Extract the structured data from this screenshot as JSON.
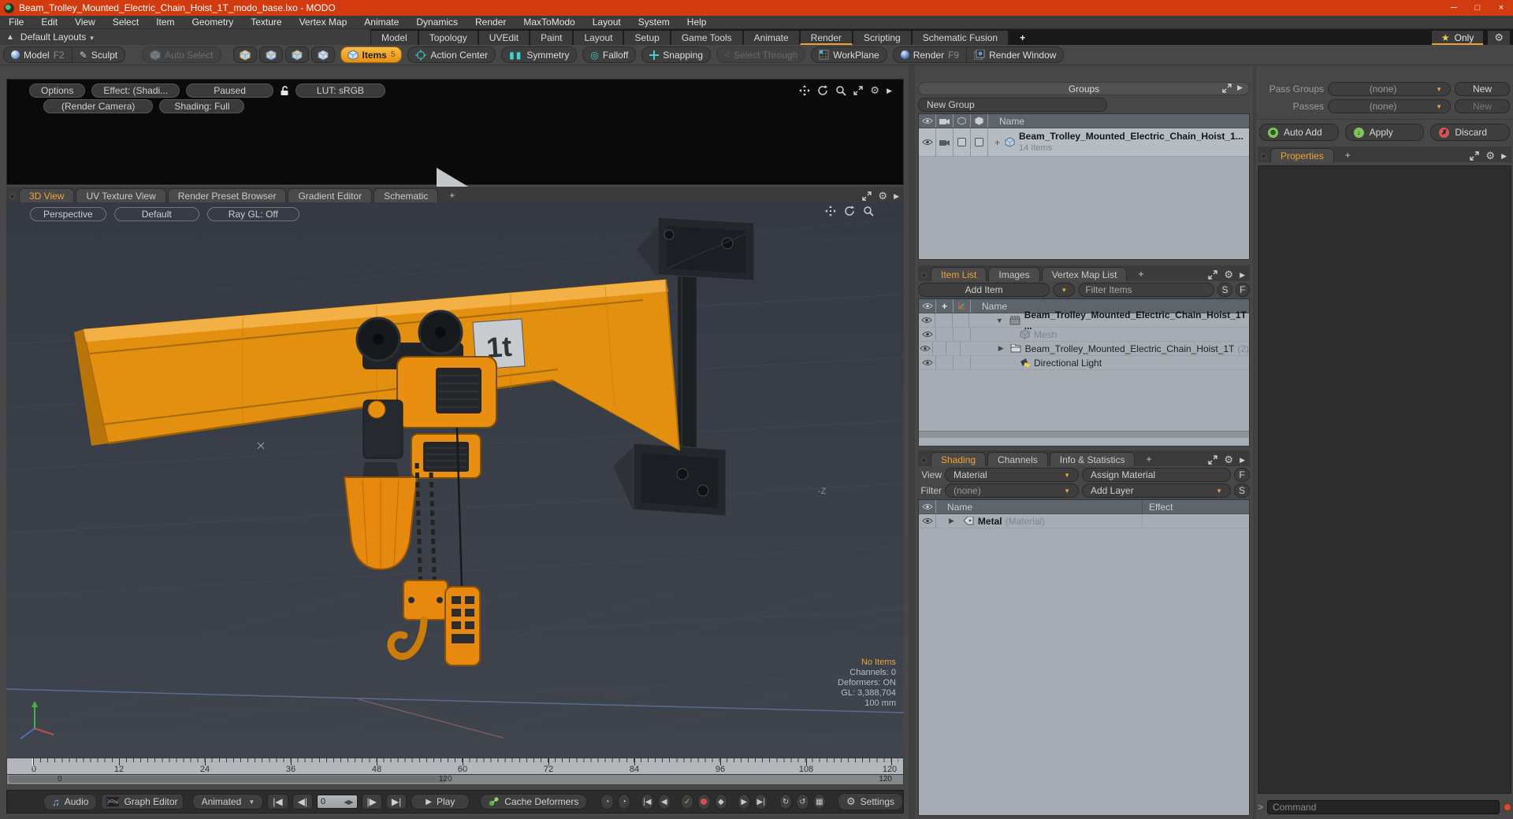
{
  "window": {
    "title": "Beam_Trolley_Mounted_Electric_Chain_Hoist_1T_modo_base.lxo - MODO"
  },
  "icons": {
    "star": "★",
    "gear": "⚙",
    "play": "▶",
    "tri_down": "▼",
    "tri_right": "▶",
    "plus": "+",
    "up_arrow": "▲",
    "dropdown_caret": "▼",
    "minimize": "─",
    "maximize": "□",
    "close": "×",
    "note": "♫",
    "loop": "↻",
    "prompt": ">",
    "expander": "+"
  },
  "menu": {
    "items": [
      "File",
      "Edit",
      "View",
      "Select",
      "Item",
      "Geometry",
      "Texture",
      "Vertex Map",
      "Animate",
      "Dynamics",
      "Render",
      "MaxToModo",
      "Layout",
      "System",
      "Help"
    ]
  },
  "layout_bar": {
    "switcher": "Default Layouts",
    "tabs": [
      "Model",
      "Topology",
      "UVEdit",
      "Paint",
      "Layout",
      "Setup",
      "Game Tools",
      "Animate",
      "Render",
      "Scripting",
      "Schematic Fusion",
      "+"
    ],
    "only": "Only"
  },
  "toolbar": {
    "model": "Model",
    "model_key": "F2",
    "sculpt": "Sculpt",
    "auto_select": "Auto Select",
    "items": "Items",
    "items_key": "5",
    "action_center": "Action Center",
    "symmetry": "Symmetry",
    "falloff": "Falloff",
    "snapping": "Snapping",
    "select_through": "Select Through",
    "workplane": "WorkPlane",
    "render": "Render",
    "render_key": "F9",
    "render_window": "Render Window"
  },
  "render_preview": {
    "options": "Options",
    "effect": "Effect: (Shadi...",
    "paused": "Paused",
    "lut": "LUT: sRGB",
    "camera": "(Render Camera)",
    "shading": "Shading: Full"
  },
  "viewport": {
    "tabs": [
      "3D View",
      "UV Texture View",
      "Render Preset Browser",
      "Gradient Editor",
      "Schematic",
      "+"
    ],
    "controls": [
      "Perspective",
      "Default",
      "Ray GL: Off"
    ],
    "beam_label": "1t",
    "axis_label": "-Z",
    "hud": [
      "No Items",
      "Channels: 0",
      "Deformers: ON",
      "GL: 3,388,704",
      "100 mm"
    ]
  },
  "groups_panel": {
    "title": "Groups",
    "new_group": "New Group",
    "name_col": "Name",
    "row": {
      "name": "Beam_Trolley_Mounted_Electric_Chain_Hoist_1...",
      "count": "14 Items"
    }
  },
  "item_list": {
    "tabs": [
      "Item List",
      "Images",
      "Vertex Map List",
      "+"
    ],
    "add_item": "Add Item",
    "filter_placeholder": "Filter Items",
    "s": "S",
    "f": "F",
    "name_col": "Name",
    "rows": [
      {
        "name": "Beam_Trolley_Mounted_Electric_Chain_Hoist_1T ...",
        "suffix": ""
      },
      {
        "name": "Mesh",
        "suffix": ""
      },
      {
        "name": "Beam_Trolley_Mounted_Electric_Chain_Hoist_1T",
        "suffix": "(2)"
      },
      {
        "name": "Directional Light",
        "suffix": ""
      }
    ]
  },
  "shading_panel": {
    "tabs": [
      "Shading",
      "Channels",
      "Info & Statistics",
      "+"
    ],
    "view_label": "View",
    "view_value": "Material",
    "assign": "Assign Material",
    "f": "F",
    "filter_label": "Filter",
    "filter_value": "(none)",
    "add_layer": "Add Layer",
    "s": "S",
    "name_col": "Name",
    "effect_col": "Effect",
    "row": {
      "name": "Metal",
      "type": "(Material)"
    }
  },
  "pass_panel": {
    "pass_groups_label": "Pass Groups",
    "passes_label": "Passes",
    "none": "(none)",
    "new": "New",
    "auto_add": "Auto Add",
    "apply": "Apply",
    "discard": "Discard"
  },
  "properties_panel": {
    "tab": "Properties",
    "add": "+"
  },
  "timeline": {
    "ticks": [
      "0",
      "12",
      "24",
      "36",
      "48",
      "60",
      "72",
      "84",
      "96",
      "108",
      "120"
    ],
    "range_start": "0",
    "range_mid": "120",
    "range_end": "120"
  },
  "transport": {
    "audio": "Audio",
    "graph_editor": "Graph Editor",
    "anim_mode": "Animated",
    "frame": "0",
    "play": "Play",
    "cache_deformers": "Cache Deformers",
    "settings": "Settings"
  },
  "command_bar": {
    "placeholder": "Command"
  }
}
